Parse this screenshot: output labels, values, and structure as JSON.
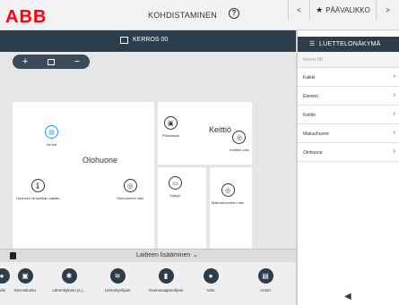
{
  "app": {
    "logo": "ABB",
    "title": "KOHDISTAMINEN"
  },
  "nav": {
    "prev": "<",
    "main_menu": "PÄÄVALIKKO",
    "next": ">"
  },
  "floor": {
    "name": "KERROS 00"
  },
  "zoom": {
    "plus": "+",
    "minus": "−"
  },
  "rooms": {
    "olohuone": {
      "name": "Olohuone",
      "devices": [
        {
          "label": "Verhot"
        },
        {
          "label": "Huoneen lämpötilan säädin"
        },
        {
          "label": "Olohuoneen valo"
        }
      ]
    },
    "keittio": {
      "name": "Keittiö",
      "devices": [
        {
          "label": "Pistorasiat"
        },
        {
          "label": "Keittiön valo"
        }
      ]
    },
    "kylpy": {
      "devices": [
        {
          "label": "Kylpyh"
        }
      ]
    },
    "makuu": {
      "devices": [
        {
          "label": "Makuuhuoneen valo"
        }
      ]
    }
  },
  "add_devices": {
    "label": "Laitteen lisääminen"
  },
  "palette": [
    {
      "label": "valo"
    },
    {
      "label": "Kerroskutsu"
    },
    {
      "label": "Lämmityksen ja j..."
    },
    {
      "label": "Lämmityshjain"
    },
    {
      "label": "Ovenavaajanohjain"
    },
    {
      "label": "Valo"
    },
    {
      "label": "Anturi"
    }
  ],
  "panel": {
    "header": "LUETTELONÄKYMÄ",
    "floor": "Kerros 00",
    "items": [
      {
        "label": "Kaikki"
      },
      {
        "label": "Eteinen"
      },
      {
        "label": "Keittiö"
      },
      {
        "label": "Makuuhuone"
      },
      {
        "label": "Olohuone"
      }
    ]
  },
  "colors": {
    "accent": "#1a9ad6",
    "dark": "#2c3e4c",
    "brand": "#ff000f"
  }
}
